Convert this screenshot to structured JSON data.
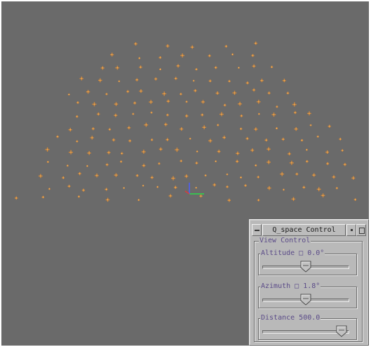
{
  "colors": {
    "viewport_background": "#6a6a6a",
    "particle": "#d98a36",
    "particle_highlight": "#f4cf8a",
    "axis_x": "#2bd94a",
    "axis_y": "#4a5cff",
    "axis_z": "#e03a3a",
    "panel_background": "#b9b9b9",
    "group_label": "#5a4a88"
  },
  "icons": {
    "window_menu": "dash-icon",
    "minimize": "dot-icon",
    "maximize": "box-icon"
  },
  "window": {
    "title": "Q_space Control"
  },
  "view_control": {
    "label": "View Control",
    "altitude": {
      "label": "Altitude □ 0.0°",
      "position": 0.5
    },
    "azimuth": {
      "label": "Azimuth □ 1.8°",
      "position": 0.5
    },
    "distance": {
      "label": "Distance 500.0",
      "position": 0.97
    }
  }
}
